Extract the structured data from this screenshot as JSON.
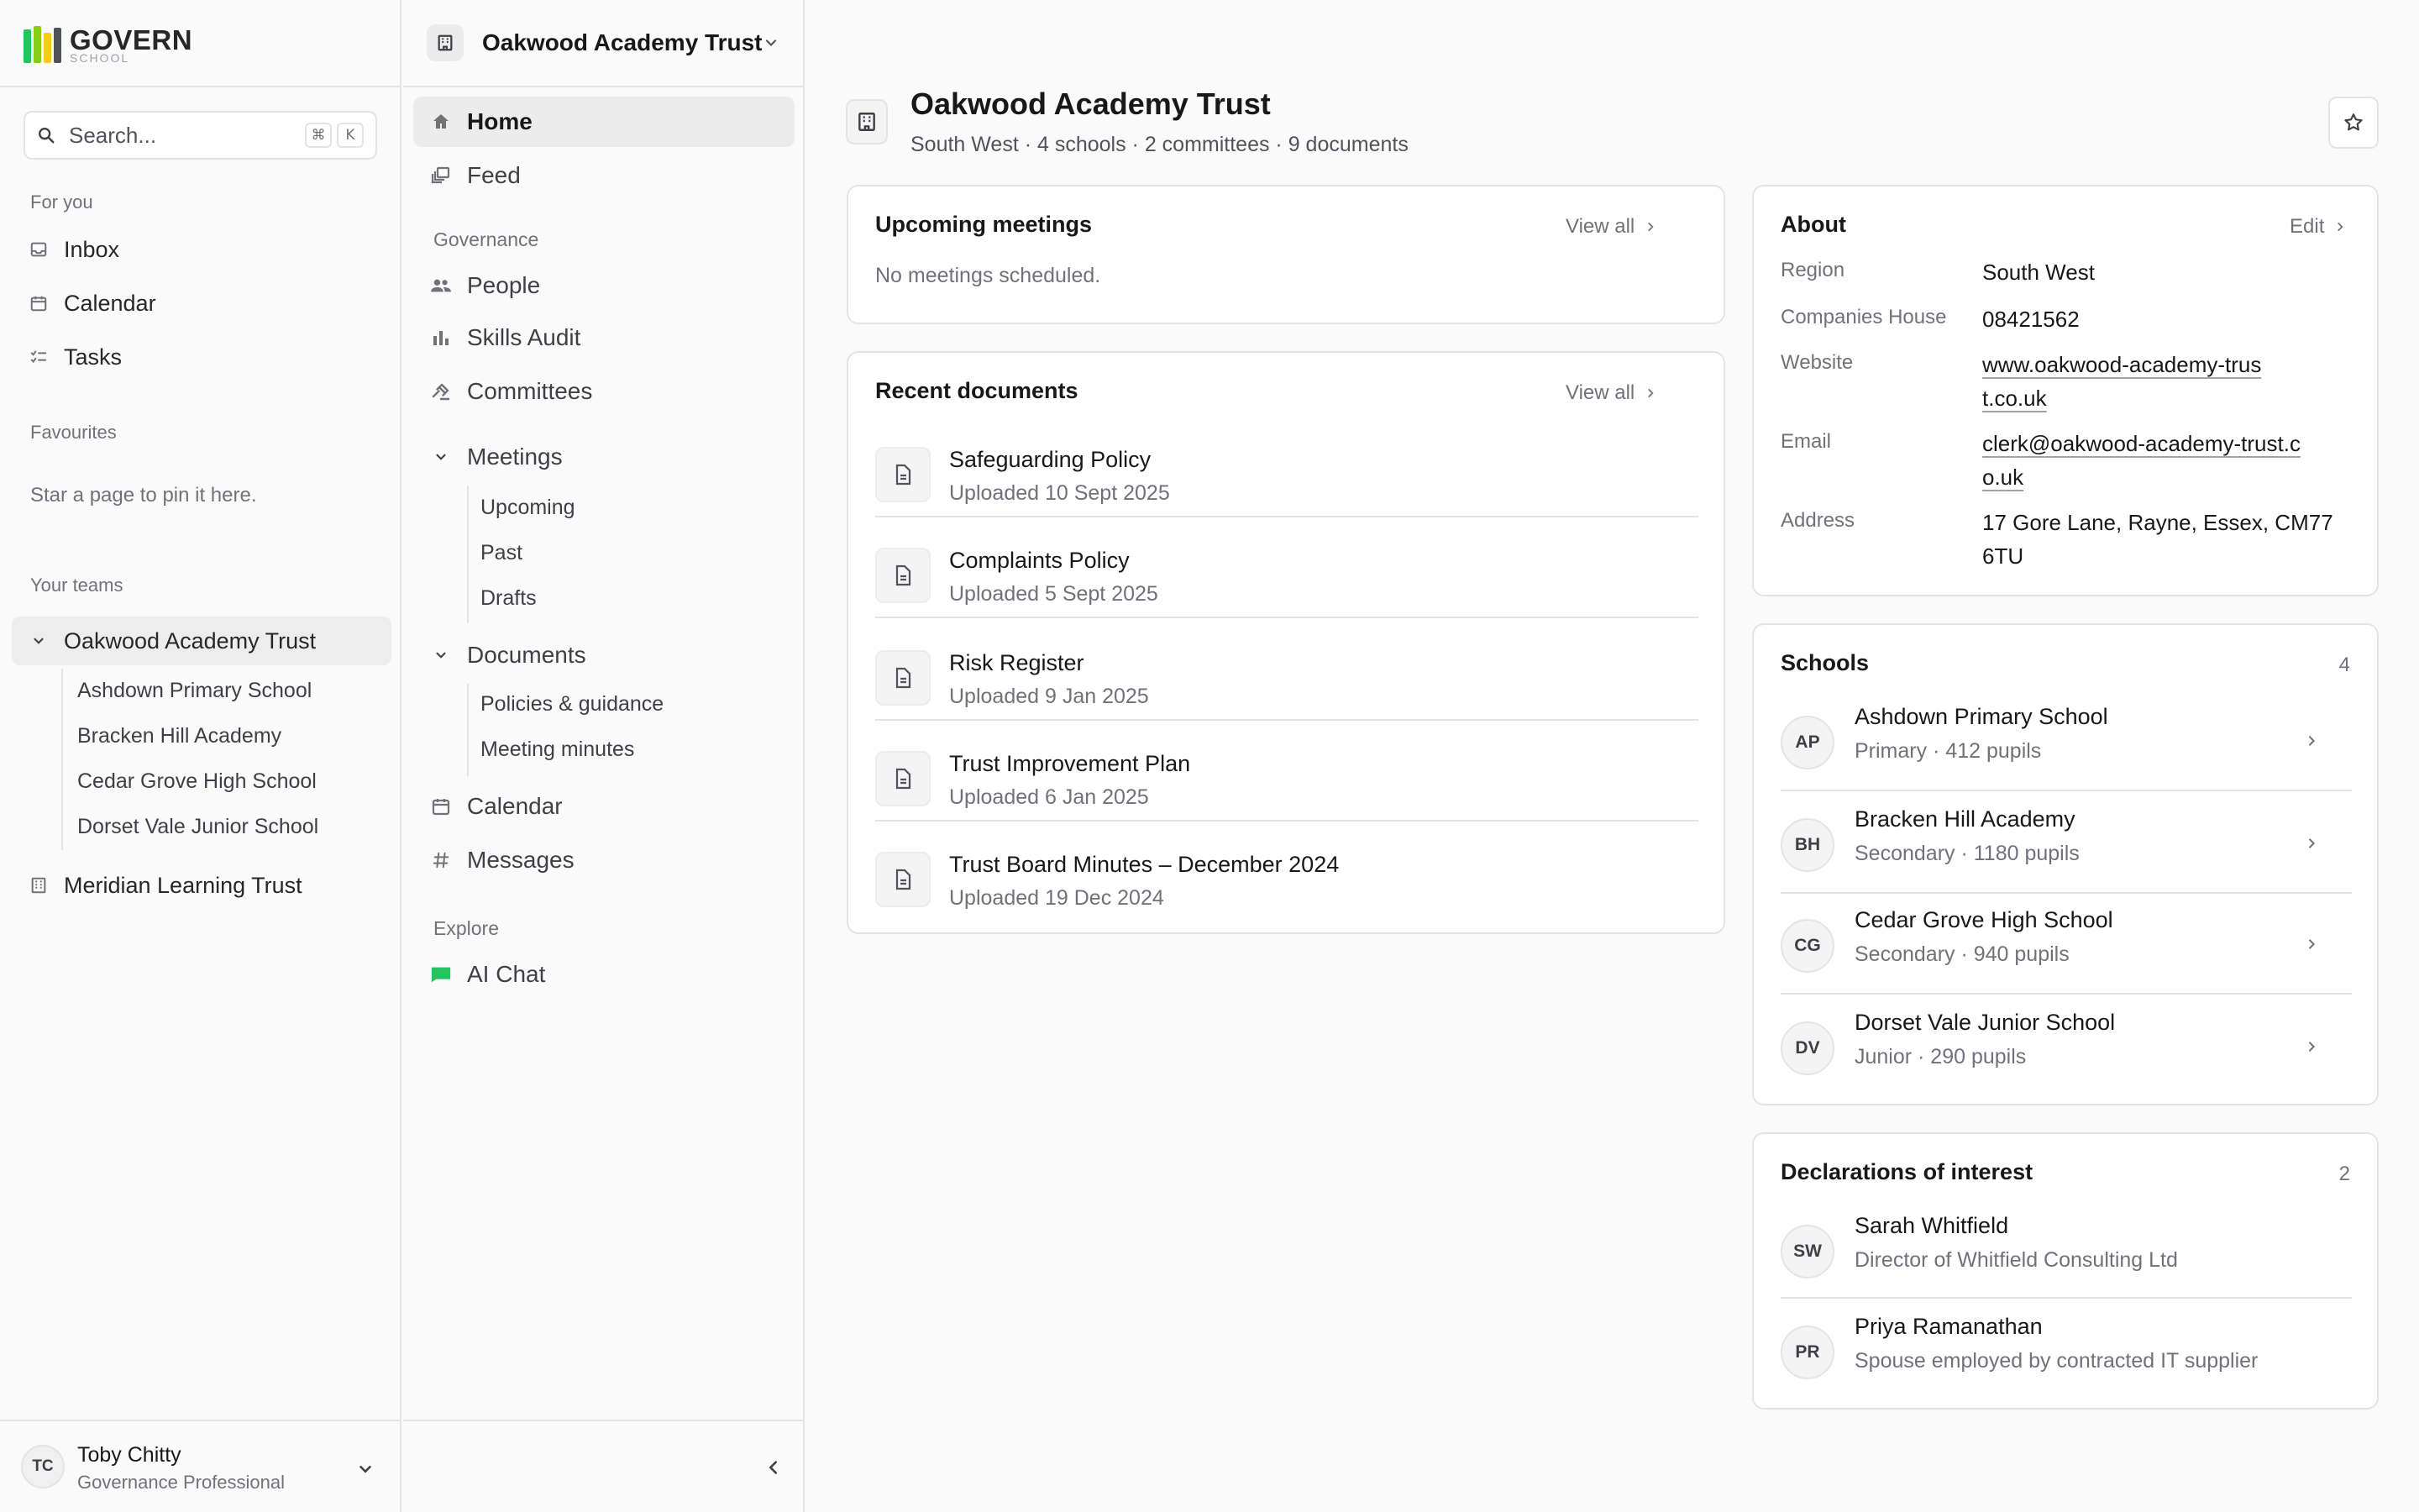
{
  "app": {
    "logo_text": "GOVERN",
    "logo_sub": "SCHOOL",
    "logo_colors": [
      "#22c55e",
      "#84cc16",
      "#facc15",
      "#52525b"
    ]
  },
  "search": {
    "placeholder": "Search...",
    "shortcut_keys": [
      "⌘",
      "K"
    ]
  },
  "sidebar": {
    "for_you_heading": "For you",
    "for_you": [
      {
        "label": "Inbox",
        "icon": "inbox-icon"
      },
      {
        "label": "Calendar",
        "icon": "calendar-icon"
      },
      {
        "label": "Tasks",
        "icon": "tasks-icon"
      }
    ],
    "favourites_heading": "Favourites",
    "favourites_empty": "Star a page to pin it here.",
    "teams_heading": "Your teams",
    "teams": [
      {
        "label": "Oakwood Academy Trust",
        "expanded": true,
        "children": [
          "Ashdown Primary School",
          "Bracken Hill Academy",
          "Cedar Grove High School",
          "Dorset Vale Junior School"
        ]
      },
      {
        "label": "Meridian Learning Trust",
        "expanded": false
      }
    ]
  },
  "user": {
    "initials": "TC",
    "name": "Toby Chitty",
    "role": "Governance Professional"
  },
  "nav": {
    "org_name": "Oakwood Academy Trust",
    "home": "Home",
    "feed": "Feed",
    "governance_heading": "Governance",
    "people": "People",
    "skills_audit": "Skills Audit",
    "committees": "Committees",
    "meetings": "Meetings",
    "meetings_children": [
      "Upcoming",
      "Past",
      "Drafts"
    ],
    "documents": "Documents",
    "documents_children": [
      "Policies & guidance",
      "Meeting minutes"
    ],
    "calendar": "Calendar",
    "messages": "Messages",
    "explore_heading": "Explore",
    "ai_chat": "AI Chat"
  },
  "page": {
    "title": "Oakwood Academy Trust",
    "subtitle": "South West · 4 schools · 2 committees · 9 documents"
  },
  "meetings_card": {
    "title": "Upcoming meetings",
    "action": "View all",
    "empty": "No meetings scheduled."
  },
  "documents_card": {
    "title": "Recent documents",
    "action": "View all",
    "items": [
      {
        "title": "Safeguarding Policy",
        "meta": "Uploaded 10 Sept 2025"
      },
      {
        "title": "Complaints Policy",
        "meta": "Uploaded 5 Sept 2025"
      },
      {
        "title": "Risk Register",
        "meta": "Uploaded 9 Jan 2025"
      },
      {
        "title": "Trust Improvement Plan",
        "meta": "Uploaded 6 Jan 2025"
      },
      {
        "title": "Trust Board Minutes – December 2024",
        "meta": "Uploaded 19 Dec 2024"
      }
    ]
  },
  "about_card": {
    "title": "About",
    "action": "Edit",
    "region_label": "Region",
    "region": "South West",
    "companies_label": "Companies House",
    "companies": "08421562",
    "website_label": "Website",
    "website": "www.oakwood-academy-trust.co.uk",
    "email_label": "Email",
    "email": "clerk@oakwood-academy-trust.co.uk",
    "address_label": "Address",
    "address": "17 Gore Lane, Rayne, Essex, CM77 6TU"
  },
  "schools_card": {
    "title": "Schools",
    "count": "4",
    "items": [
      {
        "initials": "AP",
        "name": "Ashdown Primary School",
        "meta": "Primary · 412 pupils"
      },
      {
        "initials": "BH",
        "name": "Bracken Hill Academy",
        "meta": "Secondary · 1180 pupils"
      },
      {
        "initials": "CG",
        "name": "Cedar Grove High School",
        "meta": "Secondary · 940 pupils"
      },
      {
        "initials": "DV",
        "name": "Dorset Vale Junior School",
        "meta": "Junior · 290 pupils"
      }
    ]
  },
  "declarations_card": {
    "title": "Declarations of interest",
    "count": "2",
    "items": [
      {
        "initials": "SW",
        "name": "Sarah Whitfield",
        "meta": "Director of Whitfield Consulting Ltd"
      },
      {
        "initials": "PR",
        "name": "Priya Ramanathan",
        "meta": "Spouse employed by contracted IT supplier"
      }
    ]
  },
  "colors": {
    "accent_green": "#22c55e",
    "text_primary": "#18181b",
    "text_muted": "#71717a",
    "border": "#e4e4e7"
  }
}
